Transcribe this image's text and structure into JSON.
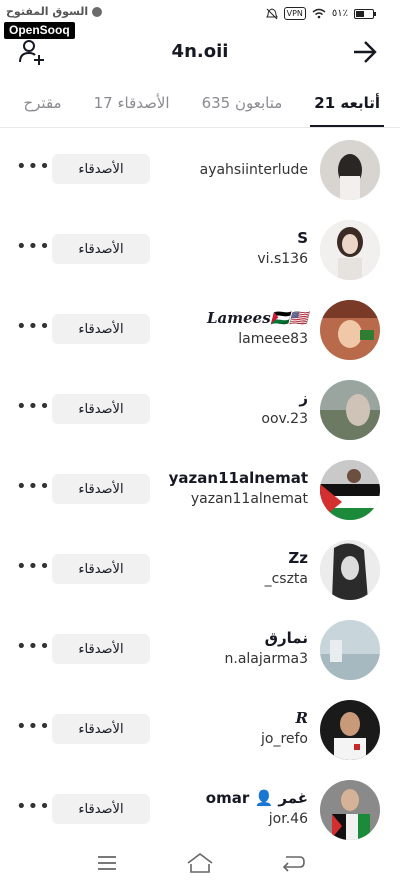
{
  "status": {
    "site_text": "السوق المفتوح",
    "watermark": "OpenSooq",
    "vpn": "VPN",
    "battery_text": "٥١٪",
    "battery_level": 0.51
  },
  "header": {
    "title": "4n.oii"
  },
  "tabs": [
    {
      "label": "أتابعه 21",
      "active": true
    },
    {
      "label": "متابعون 635",
      "active": false
    },
    {
      "label": "الأصدقاء 17",
      "active": false
    },
    {
      "label": "مقترح",
      "active": false
    }
  ],
  "rows": [
    {
      "display_name": "",
      "username": "ayahsiinterlude",
      "button": "الأصدقاء"
    },
    {
      "display_name": "S",
      "username": "vi.s136",
      "button": "الأصدقاء"
    },
    {
      "display_name": "Lamees🇵🇸🇺🇸",
      "username": "lameee83",
      "button": "الأصدقاء"
    },
    {
      "display_name": "ز",
      "username": "oov.23",
      "button": "الأصدقاء"
    },
    {
      "display_name": "yazan11alnemat",
      "username": "yazan11alnemat",
      "button": "الأصدقاء"
    },
    {
      "display_name": "Zz",
      "username": "_cszta",
      "button": "الأصدقاء"
    },
    {
      "display_name": "نمارق",
      "username": "n.alajarma3",
      "button": "الأصدقاء"
    },
    {
      "display_name": "R",
      "username": "jo_refo",
      "button": "الأصدقاء"
    },
    {
      "display_name": "omar 👤 غمر",
      "username": "jor.46",
      "button": "الأصدقاء"
    }
  ],
  "more_label": "•••"
}
